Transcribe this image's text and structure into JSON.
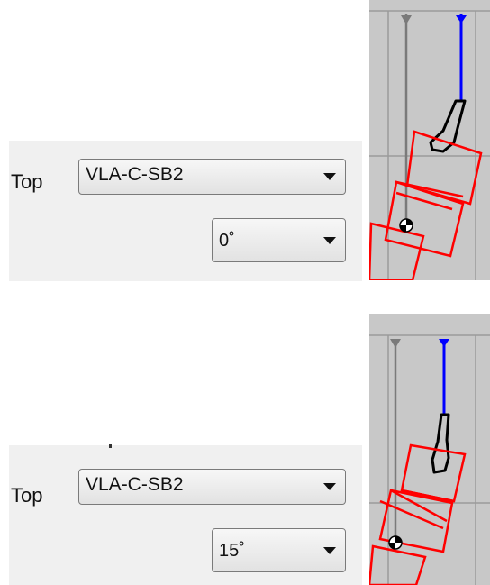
{
  "panels": [
    {
      "position_label": "Top",
      "bumper_select": {
        "value": "VLA-C-SB2"
      },
      "angle_select": {
        "value": "0˚"
      }
    },
    {
      "position_label": "Top",
      "bumper_select": {
        "value": "VLA-C-SB2"
      },
      "angle_select": {
        "value": "15˚"
      }
    }
  ],
  "colors": {
    "panel_bg": "#f0f0f0",
    "viewport_bg": "#c8c8c8",
    "cable": "#0000ff",
    "pickpoint_line": "#7a7a7a",
    "speaker_outline": "#ff0000"
  }
}
